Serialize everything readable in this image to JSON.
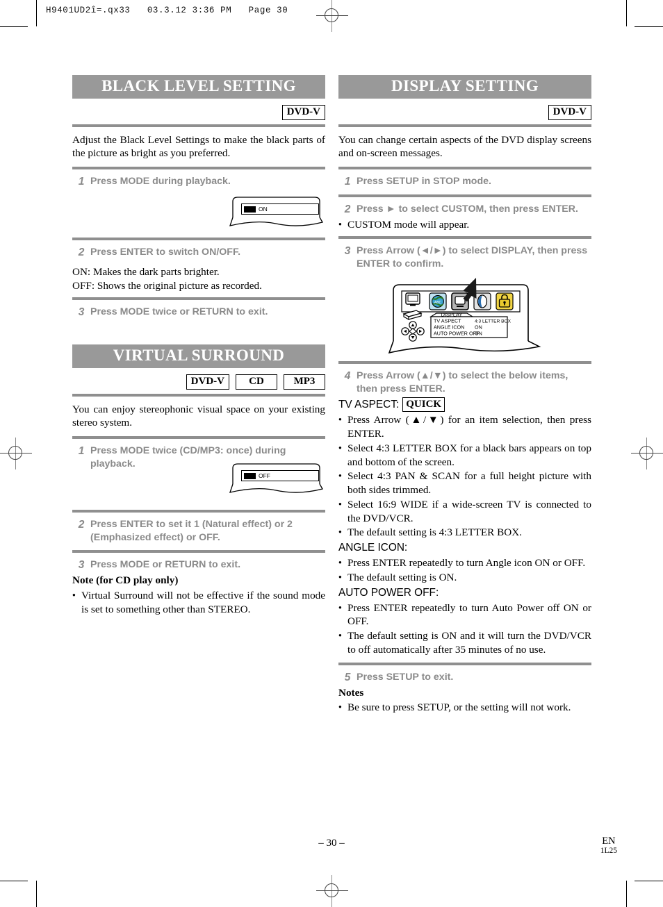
{
  "printer_slug": "H9401UD2î=.qx33   03.3.12 3:36 PM   Page 30",
  "left_column": {
    "section1": {
      "banner": "BLACK LEVEL SETTING",
      "badges": [
        "DVD-V"
      ],
      "intro": "Adjust the Black Level Settings to make the black parts of the picture as bright as you preferred.",
      "steps": [
        {
          "num": "1",
          "text": "Press MODE during playback."
        },
        {
          "num": "2",
          "text": "Press ENTER to switch ON/OFF."
        },
        {
          "num": "3",
          "text": "Press MODE twice or RETURN to exit."
        }
      ],
      "panel_display": "ON",
      "after_step2": [
        "ON: Makes the dark parts brighter.",
        "OFF: Shows the original picture as recorded."
      ]
    },
    "section2": {
      "banner": "VIRTUAL SURROUND",
      "badges": [
        "DVD-V",
        "CD",
        "MP3"
      ],
      "intro": "You can enjoy stereophonic visual space on your existing stereo system.",
      "steps": [
        {
          "num": "1",
          "text": "Press MODE twice (CD/MP3: once) during playback."
        },
        {
          "num": "2",
          "text": "Press ENTER to set it 1 (Natural effect) or 2 (Emphasized effect) or OFF."
        },
        {
          "num": "3",
          "text": "Press MODE or RETURN to exit."
        }
      ],
      "panel_display": "OFF",
      "note_heading": "Note (for CD play only)",
      "note_bullets": [
        "Virtual Surround will not be effective if the sound mode is set to something other than STEREO."
      ]
    }
  },
  "right_column": {
    "section1": {
      "banner": "DISPLAY SETTING",
      "badges": [
        "DVD-V"
      ],
      "intro": "You can change certain aspects of the DVD display screens and on-screen messages.",
      "steps": [
        {
          "num": "1",
          "text": "Press SETUP in STOP mode."
        },
        {
          "num": "2",
          "text": "Press ► to select CUSTOM, then press ENTER."
        },
        {
          "num": "3",
          "text": "Press Arrow (◄/►) to select DISPLAY, then press ENTER to confirm."
        },
        {
          "num": "4",
          "text": "Press Arrow (▲/▼) to select the below items, then press ENTER."
        },
        {
          "num": "5",
          "text": "Press SETUP to exit."
        }
      ],
      "after_step2_bullets": [
        "CUSTOM mode will appear."
      ],
      "tv_figure": {
        "menu_title": "DISPLAY",
        "rows": [
          {
            "label": "TV ASPECT",
            "value": "4:3 LETTER BOX"
          },
          {
            "label": "ANGLE ICON",
            "value": "ON"
          },
          {
            "label": "AUTO POWER OFF",
            "value": "ON"
          }
        ],
        "icons": [
          "globe-language-icon",
          "display-screen-icon",
          "audio-icon",
          "lock-icon"
        ],
        "selected_icon": "display-screen-icon"
      },
      "settings": [
        {
          "heading": "TV ASPECT:",
          "badge": "QUICK",
          "bullets": [
            "Press Arrow (▲/▼) for an item selection, then press ENTER.",
            "Select 4:3 LETTER BOX for a black bars appears on top and bottom of the screen.",
            "Select 4:3 PAN & SCAN for a full height picture with both sides trimmed.",
            "Select 16:9 WIDE if a wide-screen TV is connected to the DVD/VCR.",
            "The default setting is 4:3 LETTER BOX."
          ]
        },
        {
          "heading": "ANGLE ICON:",
          "badge": "",
          "bullets": [
            "Press ENTER repeatedly to turn Angle icon ON or OFF.",
            "The default setting is ON."
          ]
        },
        {
          "heading": "AUTO POWER OFF:",
          "badge": "",
          "bullets": [
            "Press ENTER repeatedly to turn Auto Power off ON or OFF.",
            "The default setting is ON and it will turn the DVD/VCR to off automatically after 35 minutes of no use."
          ]
        }
      ],
      "notes_heading": "Notes",
      "notes_bullets": [
        "Be sure to press SETUP, or the setting will not work."
      ]
    }
  },
  "footer": {
    "page_number": "– 30 –",
    "language_code": "EN",
    "part_code": "1L25"
  },
  "colors": {
    "banner_bg": "#999999",
    "rule": "#8f8f8f",
    "step_text": "#8a8a8a"
  }
}
